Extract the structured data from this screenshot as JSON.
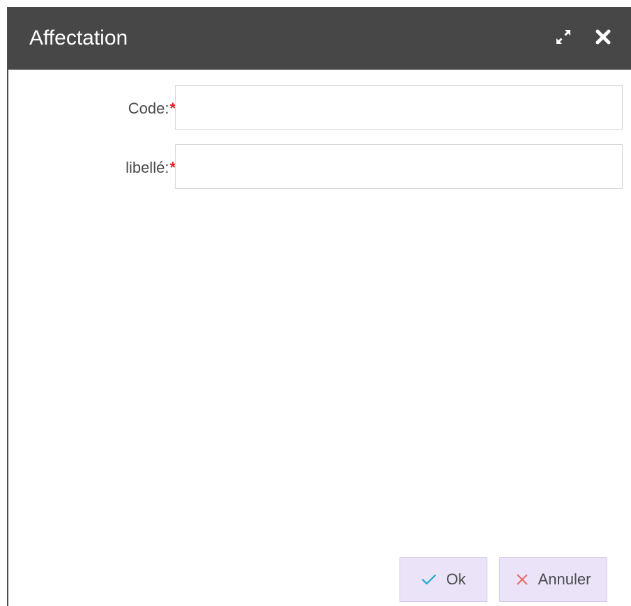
{
  "dialog": {
    "title": "Affectation",
    "maximize_icon": "expand-arrows-icon",
    "close_icon": "close-x-icon",
    "title_bar_color": "#474747"
  },
  "form": {
    "fields": [
      {
        "label": "Code:",
        "required_mark": "*",
        "value": "",
        "placeholder": ""
      },
      {
        "label": "libellé:",
        "required_mark": "*",
        "value": "",
        "placeholder": ""
      }
    ],
    "required_color": "#e31b1b"
  },
  "buttons": {
    "ok_label": "Ok",
    "ok_icon": "checkmark-icon",
    "ok_icon_color": "#1aa9c7",
    "cancel_label": "Annuler",
    "cancel_icon": "cross-icon",
    "cancel_icon_color": "#e86a6a",
    "button_bg": "#ebe3f8"
  }
}
